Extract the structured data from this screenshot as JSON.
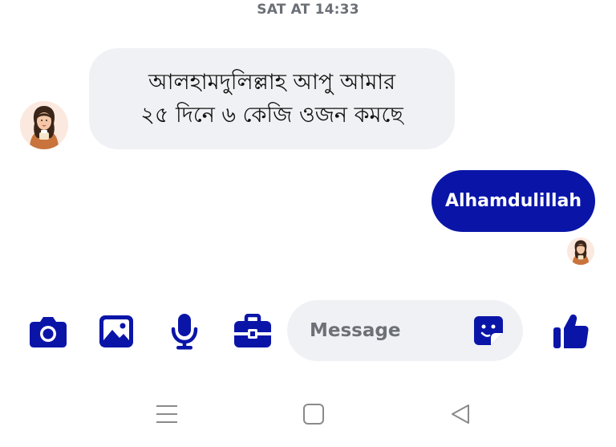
{
  "conversation": {
    "timestamp": "SAT AT 14:33"
  },
  "messages": [
    {
      "direction": "incoming",
      "lines": [
        "আলহামদুলিল্লাহ আপু আমার",
        "২৫ দিনে ৬ কেজি ওজন কমছে"
      ]
    },
    {
      "direction": "outgoing",
      "text": "Alhamdulillah"
    }
  ],
  "composer": {
    "placeholder": "Message",
    "value": "",
    "icons": [
      "camera-icon",
      "gallery-icon",
      "microphone-icon",
      "toolbox-icon",
      "sticker-icon",
      "thumbs-up-icon"
    ]
  },
  "navigation": {
    "icons": [
      "menu-icon",
      "home-icon",
      "back-icon"
    ]
  },
  "colors": {
    "accent": "#0a15a8",
    "incoming_bubble": "#f0f1f4",
    "timestamp_text": "#6b6f76",
    "nav_icon": "#8a8a8a"
  }
}
